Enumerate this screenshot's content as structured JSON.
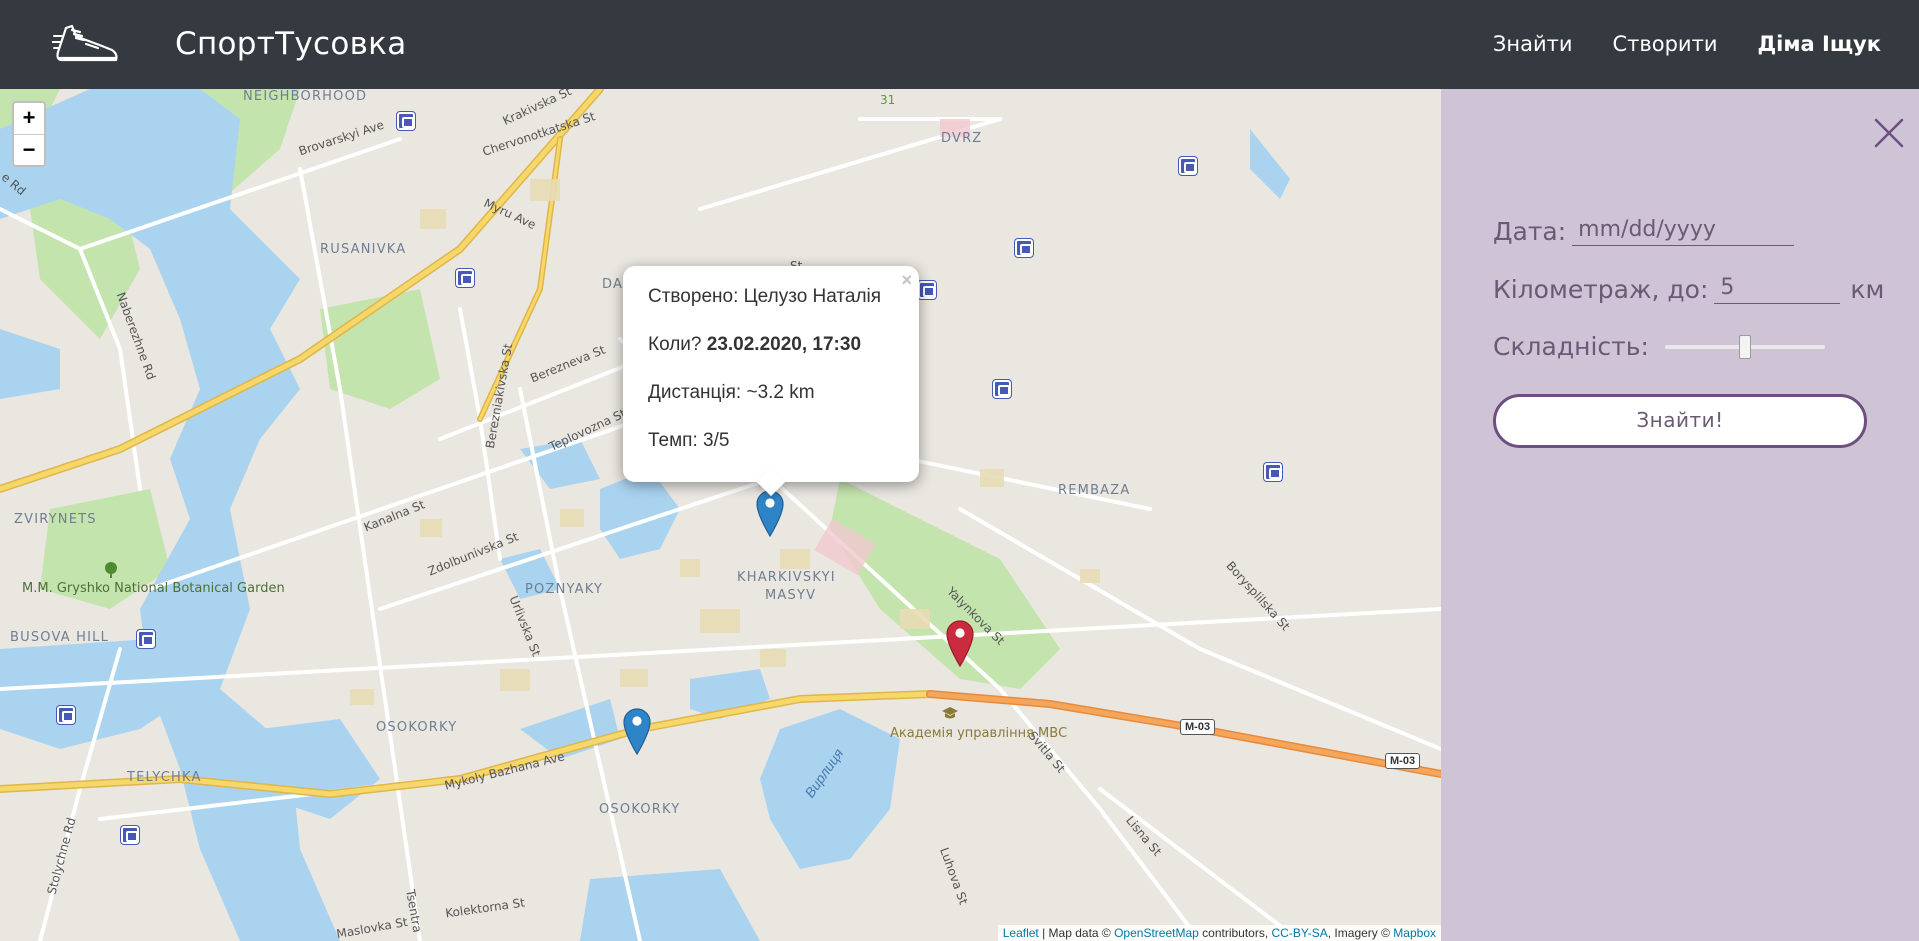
{
  "header": {
    "brand": "СпортТусовка",
    "nav": {
      "find": "Знайти",
      "create": "Створити",
      "user": "Діма Іщук"
    }
  },
  "map": {
    "zoom_in": "+",
    "zoom_out": "−",
    "districts": [
      "NEIGHBORHOOD",
      "DVRZ",
      "RUSANIVKA",
      "DA",
      "ZVIRYNETS",
      "REMBAZA",
      "KHARKIVSKYI",
      "MASYV",
      "POZNYAKY",
      "BUSOVA HILL",
      "OSOKORKY",
      "TELYCHKA",
      "OSOKORKY"
    ],
    "streets": [
      "Krakivska St",
      "Chervonotkatska St",
      "Brovarskyi Ave",
      "Myru Ave",
      "Naberezhne Rd",
      "Berezneva St",
      "Bereznіakivska St",
      "Teplovozna St",
      "Kanalna St",
      "Zdolbunivska St",
      "Urlivska St",
      "Yalynkova St",
      "Borysplilska St",
      "Svitla St",
      "Mykoly Bazhana Ave",
      "Lisna St",
      "Luhova St",
      "Stolychne Rd",
      "Kolektorna St",
      "Maslovka St",
      "Tsentra",
      "e Rd",
      "St",
      "31"
    ],
    "pois": [
      "M.M. Gryshko National Botanical Garden",
      "Академія управління МВС"
    ],
    "water": "Вирлиця",
    "highways": [
      "M-03",
      "M-03"
    ],
    "popup": {
      "close": "×",
      "created_label": "Створено: ",
      "created_value": "Целузо Наталія",
      "when_label": "Коли? ",
      "when_value": "23.02.2020, 17:30",
      "distance_label": "Дистанція: ",
      "distance_value": "~3.2 km",
      "pace_label": "Темп: ",
      "pace_value": "3/5"
    },
    "attribution": {
      "leaflet": "Leaflet",
      "sep": " | Map data © ",
      "osm": "OpenStreetMap",
      "contrib": " contributors, ",
      "license": "CC-BY-SA",
      "imagery": ", Imagery © ",
      "mapbox": "Mapbox"
    }
  },
  "panel": {
    "date_label": "Дата:",
    "date_placeholder": "mm/dd/yyyy",
    "km_label": "Кілометраж, до:",
    "km_value": "5",
    "km_unit": "км",
    "difficulty_label": "Складність:",
    "difficulty_value": 0.5,
    "find_button": "Знайти!"
  },
  "colors": {
    "header_bg": "#343a40",
    "panel_bg": "#cfc3d6",
    "accent": "#6d4f80",
    "marker_blue": "#2f83c7",
    "marker_red": "#cb2b3e",
    "water": "#a9d3f2",
    "park": "#b8e0a0",
    "highway": "#f5d35a"
  }
}
